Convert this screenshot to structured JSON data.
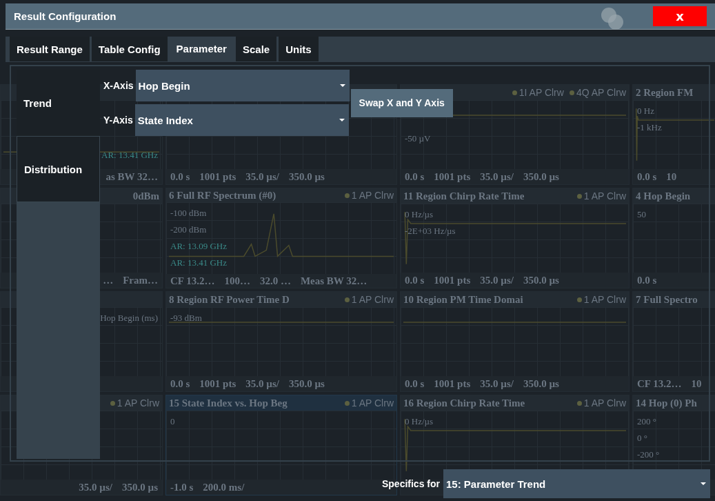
{
  "window": {
    "title": "Result Configuration",
    "close": "x"
  },
  "tabs": [
    {
      "label": "Result Range",
      "selected": false
    },
    {
      "label": "Table Config",
      "selected": false
    },
    {
      "label": "Parameter",
      "selected": true
    },
    {
      "label": "Scale",
      "selected": false
    },
    {
      "label": "Units",
      "selected": false
    }
  ],
  "nav": [
    {
      "label": "Trend",
      "selected": true
    },
    {
      "label": "Distribution",
      "selected": false
    }
  ],
  "axes": [
    {
      "label": "X-Axis",
      "value": "Hop Begin"
    },
    {
      "label": "Y-Axis",
      "value": "State Index"
    }
  ],
  "swap_button": "Swap X and Y Axis",
  "specifics": {
    "label": "Specifics for",
    "value": "15: Parameter Trend"
  },
  "background_panels": [
    {
      "labels": [
        {
          "text": "AR: 13.41 GHz",
          "kind": "marker"
        }
      ],
      "footer": [
        "as BW 32…"
      ],
      "kind": "spectrum",
      "selected": false
    },
    {
      "footer": [
        "0.0 s",
        "1001 pts",
        "35.0 µs/",
        "350.0 µs"
      ],
      "selected": false
    },
    {
      "traces": [
        "1I AP Clrw",
        "4Q AP Clrw"
      ],
      "labels": [
        {
          "text": "-50 µV",
          "kind": "axis"
        }
      ],
      "footer": [
        "0.0 s",
        "1001 pts",
        "35.0 µs/",
        "350.0 µs"
      ],
      "kind": "flat",
      "selected": false
    },
    {
      "title": "2 Region FM",
      "labels": [
        {
          "text": "0 Hz",
          "kind": "axis"
        },
        {
          "text": "-1 kHz",
          "kind": "axis"
        }
      ],
      "footer": [
        "0.0 s",
        "10"
      ],
      "kind": "step",
      "selected": false
    },
    {
      "title": "0dBm",
      "footer": [
        "…",
        "Fram…"
      ],
      "selected": false
    },
    {
      "title": "6 Full RF Spectrum (#0)",
      "traces": [
        "1 AP Clrw"
      ],
      "labels": [
        {
          "text": "-100 dBm",
          "kind": "axis"
        },
        {
          "text": "-200 dBm",
          "kind": "axis"
        },
        {
          "text": "AR: 13.09 GHz",
          "kind": "marker"
        },
        {
          "text": "AR: 13.41 GHz",
          "kind": "marker"
        }
      ],
      "footer": [
        "CF 13.2…",
        "100…",
        "32.0 …",
        "Meas BW 32…"
      ],
      "kind": "spectrum",
      "selected": false
    },
    {
      "title": "11 Region Chirp Rate Time",
      "traces": [
        "1 AP Clrw"
      ],
      "labels": [
        {
          "text": "0 Hz/µs",
          "kind": "axis"
        },
        {
          "text": "-2E+03 Hz/µs",
          "kind": "axis"
        }
      ],
      "footer": [
        "0.0 s",
        "1001 pts",
        "35.0 µs/",
        "350.0 µs"
      ],
      "kind": "step",
      "selected": false
    },
    {
      "title": "4 Hop Begin",
      "labels": [
        {
          "text": "50",
          "kind": "axis"
        }
      ],
      "footer": [
        "0.0 s"
      ],
      "selected": false
    },
    {
      "labels": [
        {
          "text": "Hop Begin (ms)",
          "kind": "axis"
        }
      ],
      "selected": false
    },
    {
      "title": "8 Region RF Power Time D",
      "traces": [
        "1 AP Clrw"
      ],
      "labels": [
        {
          "text": "-93 dBm",
          "kind": "axis"
        }
      ],
      "footer": [
        "0.0 s",
        "1001 pts",
        "35.0 µs/",
        "350.0 µs"
      ],
      "kind": "flat",
      "selected": false
    },
    {
      "title": "10 Region PM Time Domai",
      "traces": [
        "1 AP Clrw"
      ],
      "footer": [
        "0.0 s",
        "1001 pts",
        "35.0 µs/",
        "350.0 µs"
      ],
      "kind": "flat",
      "selected": false
    },
    {
      "title": "7 Full Spectro",
      "footer": [
        "CF 13.2…",
        "10"
      ],
      "selected": false
    },
    {
      "traces": [
        "1 AP Clrw"
      ],
      "footer": [
        "35.0 µs/",
        "350.0 µs"
      ],
      "selected": false
    },
    {
      "title": "15 State Index vs. Hop Beg",
      "traces": [
        "1 AP Clrw"
      ],
      "labels": [
        {
          "text": "0",
          "kind": "axis"
        }
      ],
      "footer": [
        "-1.0 s",
        "200.0 ms/"
      ],
      "selected": true
    },
    {
      "title": "16 Region Chirp Rate Time",
      "traces": [
        "1 AP Clrw"
      ],
      "labels": [
        {
          "text": "0 Hz/µs",
          "kind": "axis"
        }
      ],
      "kind": "step",
      "selected": false
    },
    {
      "title": "14 Hop (0) Ph",
      "labels": [
        {
          "text": "200 °",
          "kind": "axis"
        },
        {
          "text": "0 °",
          "kind": "axis"
        },
        {
          "text": "-200 °",
          "kind": "axis"
        }
      ],
      "selected": false
    }
  ]
}
